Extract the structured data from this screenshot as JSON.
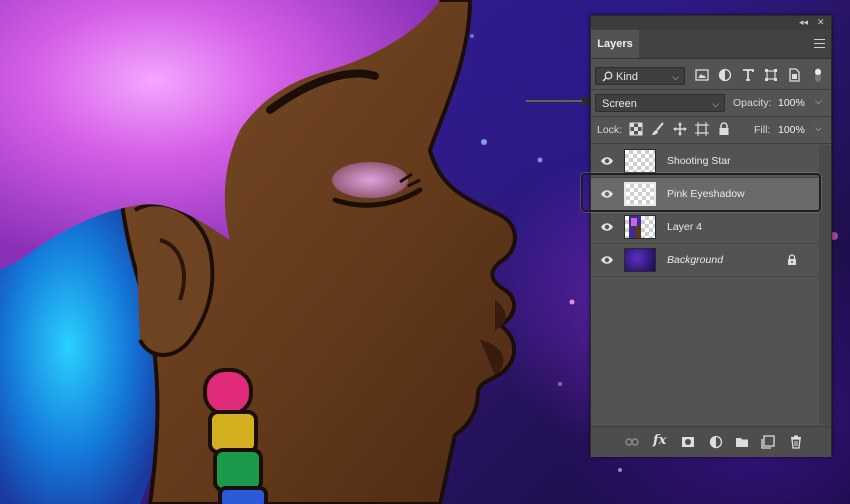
{
  "panel": {
    "tab_label": "Layers",
    "collapse_label": "◂◂",
    "close_label": "✕",
    "filter": {
      "label": "Kind",
      "search_icon": "search-icon"
    },
    "filter_icons": [
      "image-filter-icon",
      "adjustment-filter-icon",
      "type-filter-icon",
      "shape-filter-icon",
      "smart-object-filter-icon",
      "filter-toggle-icon"
    ],
    "blend_mode": "Screen",
    "opacity": {
      "label": "Opacity:",
      "value": "100%"
    },
    "lock": {
      "label": "Lock:",
      "icons": [
        "lock-transparent-icon",
        "lock-image-icon",
        "lock-position-icon",
        "lock-artboard-icon",
        "lock-all-icon"
      ]
    },
    "fill": {
      "label": "Fill:",
      "value": "100%"
    },
    "layers": [
      {
        "name": "Shooting Star",
        "visible": true,
        "selected": false,
        "thumb": "transparent",
        "locked": false,
        "italic": false
      },
      {
        "name": "Pink Eyeshadow",
        "visible": true,
        "selected": true,
        "thumb": "transparent",
        "locked": false,
        "italic": false
      },
      {
        "name": "Layer 4",
        "visible": true,
        "selected": false,
        "thumb": "art",
        "locked": false,
        "italic": false
      },
      {
        "name": "Background",
        "visible": true,
        "selected": false,
        "thumb": "background",
        "locked": true,
        "italic": true
      }
    ],
    "bottom_icons": [
      "link-layers-icon",
      "fx-icon",
      "add-mask-icon",
      "adjustment-layer-icon",
      "new-group-icon",
      "new-layer-icon",
      "delete-layer-icon"
    ],
    "fx_label": "fx"
  },
  "colors": {
    "panel_bg": "#535353",
    "selected_row": "#6a6a6a",
    "hair": "#d86ae8",
    "skin": "#6a4220",
    "background_top": "#2b1f9a"
  }
}
